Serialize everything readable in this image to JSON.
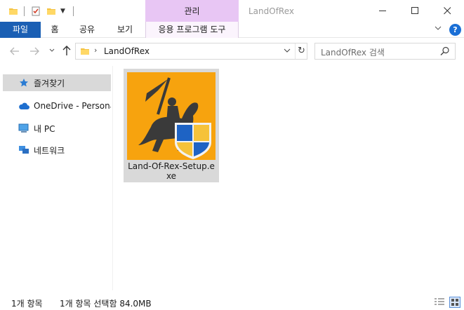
{
  "titlebar": {
    "window_title": "LandOfRex",
    "contextual_tab": "관리"
  },
  "ribbon": {
    "tabs": [
      "파일",
      "홈",
      "공유",
      "보기",
      "응용 프로그램 도구"
    ]
  },
  "address": {
    "path": "LandOfRex",
    "separator": "›"
  },
  "search": {
    "placeholder": "LandOfRex 검색"
  },
  "navpane": {
    "items": [
      {
        "label": "즐겨찾기",
        "icon": "star-icon",
        "selected": true
      },
      {
        "label": "OneDrive - Personal",
        "icon": "cloud-icon",
        "selected": false
      },
      {
        "label": "내 PC",
        "icon": "computer-icon",
        "selected": false
      },
      {
        "label": "네트워크",
        "icon": "network-icon",
        "selected": false
      }
    ]
  },
  "files": [
    {
      "name": "Land-Of-Rex-Setup.exe",
      "icon": "knight-shield-installer-icon",
      "selected": true
    }
  ],
  "status": {
    "item_count": "1개 항목",
    "selection": "1개 항목 선택함 84.0MB"
  },
  "colors": {
    "file_tab": "#1a5fb4",
    "contextual_tab": "#e8c6f4",
    "icon_background": "#f7a30e",
    "selection": "#d9d9d9"
  }
}
